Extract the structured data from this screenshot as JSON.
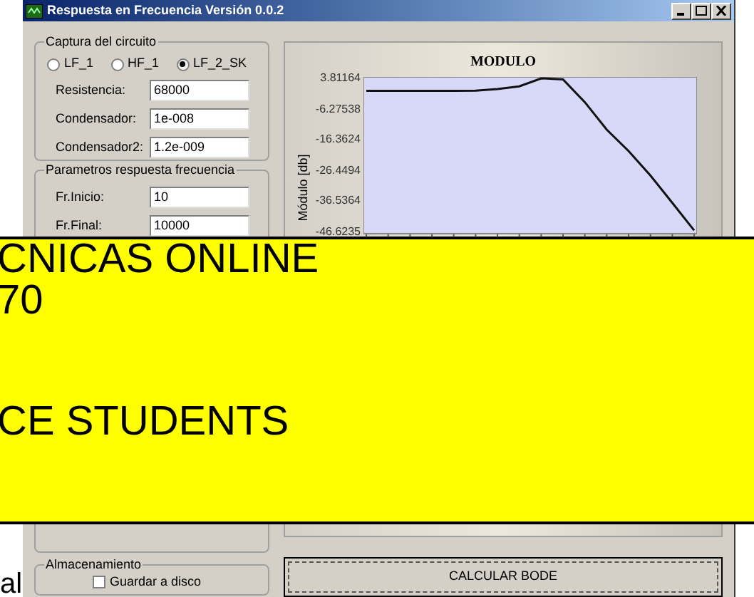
{
  "window": {
    "title": "Respuesta en Frecuencia Versión 0.0.2"
  },
  "circuit_group": {
    "title": "Captura del circuito",
    "options": [
      {
        "label": "LF_1",
        "selected": false
      },
      {
        "label": "HF_1",
        "selected": false
      },
      {
        "label": "LF_2_SK",
        "selected": true
      }
    ],
    "fields": [
      {
        "label": "Resistencia:",
        "value": "68000"
      },
      {
        "label": "Condensador:",
        "value": "1e-008"
      },
      {
        "label": "Condensador2:",
        "value": "1.2e-009"
      }
    ]
  },
  "params_group": {
    "title": "Parametros respuesta frecuencia",
    "fields": [
      {
        "label": "Fr.Inicio:",
        "value": "10"
      },
      {
        "label": "Fr.Final:",
        "value": "10000"
      }
    ]
  },
  "storage_group": {
    "title": "Almacenamiento",
    "checkbox": {
      "label": "Guardar a disco",
      "checked": false
    }
  },
  "chart": {
    "chart_data": {
      "type": "line",
      "title": "MODULO",
      "ylabel": "Módulo [db]",
      "ylim": [
        -46.6235,
        3.81164
      ],
      "yticks": [
        {
          "value": 3.81164,
          "label": "3.81164"
        },
        {
          "value": -6.27538,
          "label": "-6.27538"
        },
        {
          "value": -16.3624,
          "label": "-16.3624"
        },
        {
          "value": -26.4494,
          "label": "-26.4494"
        },
        {
          "value": -36.5364,
          "label": "-36.5364"
        },
        {
          "value": -46.6235,
          "label": "-46.6235"
        }
      ],
      "categories": [
        null,
        null,
        null,
        null,
        null,
        null,
        null,
        null,
        null,
        null,
        null,
        null,
        null,
        null,
        null,
        null
      ],
      "series": [
        {
          "color": "#111111",
          "values": [
            -0.3,
            -0.3,
            -0.3,
            -0.3,
            -0.3,
            -0.2,
            0.3,
            1.2,
            3.8,
            3.5,
            -4,
            -13,
            -20,
            -28,
            -37,
            -46
          ]
        }
      ]
    }
  },
  "calc_button": "CALCULAR BODE",
  "overlay": {
    "lines": [
      "CNICAS ONLINE",
      "70",
      "CE STUDENTS"
    ]
  },
  "corner_text": "al"
}
